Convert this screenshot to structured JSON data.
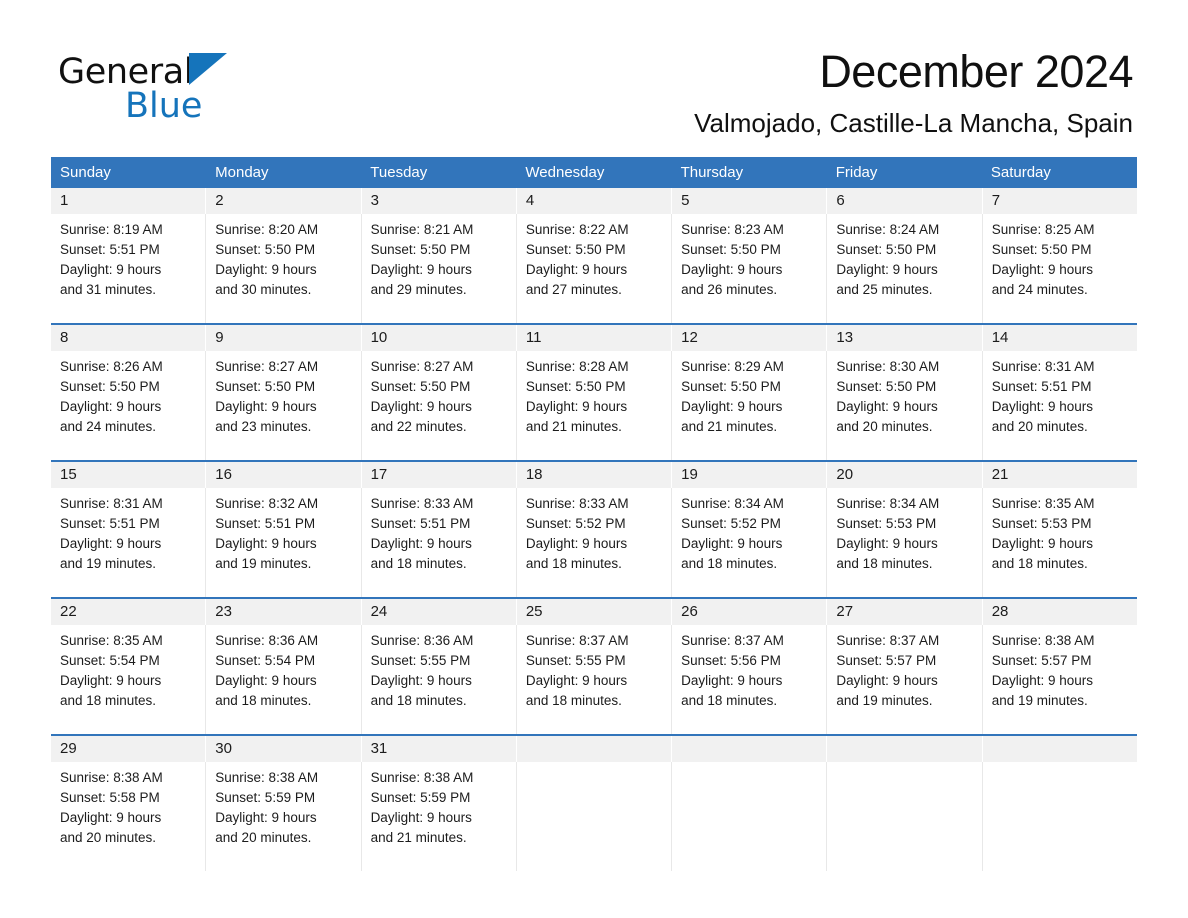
{
  "brand": {
    "name_part1": "General",
    "name_part2": "Blue",
    "triangle_icon": "triangle-icon",
    "accent_color": "#1574bb"
  },
  "header": {
    "title": "December 2024",
    "subtitle": "Valmojado, Castille-La Mancha, Spain"
  },
  "calendar": {
    "header_bg_color": "#3275bb",
    "daynum_bg_color": "#f1f1f1",
    "weekdays": [
      "Sunday",
      "Monday",
      "Tuesday",
      "Wednesday",
      "Thursday",
      "Friday",
      "Saturday"
    ],
    "weeks": [
      {
        "days": [
          {
            "num": "1",
            "sunrise": "Sunrise: 8:19 AM",
            "sunset": "Sunset: 5:51 PM",
            "daylight1": "Daylight: 9 hours",
            "daylight2": "and 31 minutes."
          },
          {
            "num": "2",
            "sunrise": "Sunrise: 8:20 AM",
            "sunset": "Sunset: 5:50 PM",
            "daylight1": "Daylight: 9 hours",
            "daylight2": "and 30 minutes."
          },
          {
            "num": "3",
            "sunrise": "Sunrise: 8:21 AM",
            "sunset": "Sunset: 5:50 PM",
            "daylight1": "Daylight: 9 hours",
            "daylight2": "and 29 minutes."
          },
          {
            "num": "4",
            "sunrise": "Sunrise: 8:22 AM",
            "sunset": "Sunset: 5:50 PM",
            "daylight1": "Daylight: 9 hours",
            "daylight2": "and 27 minutes."
          },
          {
            "num": "5",
            "sunrise": "Sunrise: 8:23 AM",
            "sunset": "Sunset: 5:50 PM",
            "daylight1": "Daylight: 9 hours",
            "daylight2": "and 26 minutes."
          },
          {
            "num": "6",
            "sunrise": "Sunrise: 8:24 AM",
            "sunset": "Sunset: 5:50 PM",
            "daylight1": "Daylight: 9 hours",
            "daylight2": "and 25 minutes."
          },
          {
            "num": "7",
            "sunrise": "Sunrise: 8:25 AM",
            "sunset": "Sunset: 5:50 PM",
            "daylight1": "Daylight: 9 hours",
            "daylight2": "and 24 minutes."
          }
        ]
      },
      {
        "days": [
          {
            "num": "8",
            "sunrise": "Sunrise: 8:26 AM",
            "sunset": "Sunset: 5:50 PM",
            "daylight1": "Daylight: 9 hours",
            "daylight2": "and 24 minutes."
          },
          {
            "num": "9",
            "sunrise": "Sunrise: 8:27 AM",
            "sunset": "Sunset: 5:50 PM",
            "daylight1": "Daylight: 9 hours",
            "daylight2": "and 23 minutes."
          },
          {
            "num": "10",
            "sunrise": "Sunrise: 8:27 AM",
            "sunset": "Sunset: 5:50 PM",
            "daylight1": "Daylight: 9 hours",
            "daylight2": "and 22 minutes."
          },
          {
            "num": "11",
            "sunrise": "Sunrise: 8:28 AM",
            "sunset": "Sunset: 5:50 PM",
            "daylight1": "Daylight: 9 hours",
            "daylight2": "and 21 minutes."
          },
          {
            "num": "12",
            "sunrise": "Sunrise: 8:29 AM",
            "sunset": "Sunset: 5:50 PM",
            "daylight1": "Daylight: 9 hours",
            "daylight2": "and 21 minutes."
          },
          {
            "num": "13",
            "sunrise": "Sunrise: 8:30 AM",
            "sunset": "Sunset: 5:50 PM",
            "daylight1": "Daylight: 9 hours",
            "daylight2": "and 20 minutes."
          },
          {
            "num": "14",
            "sunrise": "Sunrise: 8:31 AM",
            "sunset": "Sunset: 5:51 PM",
            "daylight1": "Daylight: 9 hours",
            "daylight2": "and 20 minutes."
          }
        ]
      },
      {
        "days": [
          {
            "num": "15",
            "sunrise": "Sunrise: 8:31 AM",
            "sunset": "Sunset: 5:51 PM",
            "daylight1": "Daylight: 9 hours",
            "daylight2": "and 19 minutes."
          },
          {
            "num": "16",
            "sunrise": "Sunrise: 8:32 AM",
            "sunset": "Sunset: 5:51 PM",
            "daylight1": "Daylight: 9 hours",
            "daylight2": "and 19 minutes."
          },
          {
            "num": "17",
            "sunrise": "Sunrise: 8:33 AM",
            "sunset": "Sunset: 5:51 PM",
            "daylight1": "Daylight: 9 hours",
            "daylight2": "and 18 minutes."
          },
          {
            "num": "18",
            "sunrise": "Sunrise: 8:33 AM",
            "sunset": "Sunset: 5:52 PM",
            "daylight1": "Daylight: 9 hours",
            "daylight2": "and 18 minutes."
          },
          {
            "num": "19",
            "sunrise": "Sunrise: 8:34 AM",
            "sunset": "Sunset: 5:52 PM",
            "daylight1": "Daylight: 9 hours",
            "daylight2": "and 18 minutes."
          },
          {
            "num": "20",
            "sunrise": "Sunrise: 8:34 AM",
            "sunset": "Sunset: 5:53 PM",
            "daylight1": "Daylight: 9 hours",
            "daylight2": "and 18 minutes."
          },
          {
            "num": "21",
            "sunrise": "Sunrise: 8:35 AM",
            "sunset": "Sunset: 5:53 PM",
            "daylight1": "Daylight: 9 hours",
            "daylight2": "and 18 minutes."
          }
        ]
      },
      {
        "days": [
          {
            "num": "22",
            "sunrise": "Sunrise: 8:35 AM",
            "sunset": "Sunset: 5:54 PM",
            "daylight1": "Daylight: 9 hours",
            "daylight2": "and 18 minutes."
          },
          {
            "num": "23",
            "sunrise": "Sunrise: 8:36 AM",
            "sunset": "Sunset: 5:54 PM",
            "daylight1": "Daylight: 9 hours",
            "daylight2": "and 18 minutes."
          },
          {
            "num": "24",
            "sunrise": "Sunrise: 8:36 AM",
            "sunset": "Sunset: 5:55 PM",
            "daylight1": "Daylight: 9 hours",
            "daylight2": "and 18 minutes."
          },
          {
            "num": "25",
            "sunrise": "Sunrise: 8:37 AM",
            "sunset": "Sunset: 5:55 PM",
            "daylight1": "Daylight: 9 hours",
            "daylight2": "and 18 minutes."
          },
          {
            "num": "26",
            "sunrise": "Sunrise: 8:37 AM",
            "sunset": "Sunset: 5:56 PM",
            "daylight1": "Daylight: 9 hours",
            "daylight2": "and 18 minutes."
          },
          {
            "num": "27",
            "sunrise": "Sunrise: 8:37 AM",
            "sunset": "Sunset: 5:57 PM",
            "daylight1": "Daylight: 9 hours",
            "daylight2": "and 19 minutes."
          },
          {
            "num": "28",
            "sunrise": "Sunrise: 8:38 AM",
            "sunset": "Sunset: 5:57 PM",
            "daylight1": "Daylight: 9 hours",
            "daylight2": "and 19 minutes."
          }
        ]
      },
      {
        "days": [
          {
            "num": "29",
            "sunrise": "Sunrise: 8:38 AM",
            "sunset": "Sunset: 5:58 PM",
            "daylight1": "Daylight: 9 hours",
            "daylight2": "and 20 minutes."
          },
          {
            "num": "30",
            "sunrise": "Sunrise: 8:38 AM",
            "sunset": "Sunset: 5:59 PM",
            "daylight1": "Daylight: 9 hours",
            "daylight2": "and 20 minutes."
          },
          {
            "num": "31",
            "sunrise": "Sunrise: 8:38 AM",
            "sunset": "Sunset: 5:59 PM",
            "daylight1": "Daylight: 9 hours",
            "daylight2": "and 21 minutes."
          },
          {
            "num": "",
            "sunrise": "",
            "sunset": "",
            "daylight1": "",
            "daylight2": ""
          },
          {
            "num": "",
            "sunrise": "",
            "sunset": "",
            "daylight1": "",
            "daylight2": ""
          },
          {
            "num": "",
            "sunrise": "",
            "sunset": "",
            "daylight1": "",
            "daylight2": ""
          },
          {
            "num": "",
            "sunrise": "",
            "sunset": "",
            "daylight1": "",
            "daylight2": ""
          }
        ]
      }
    ]
  }
}
